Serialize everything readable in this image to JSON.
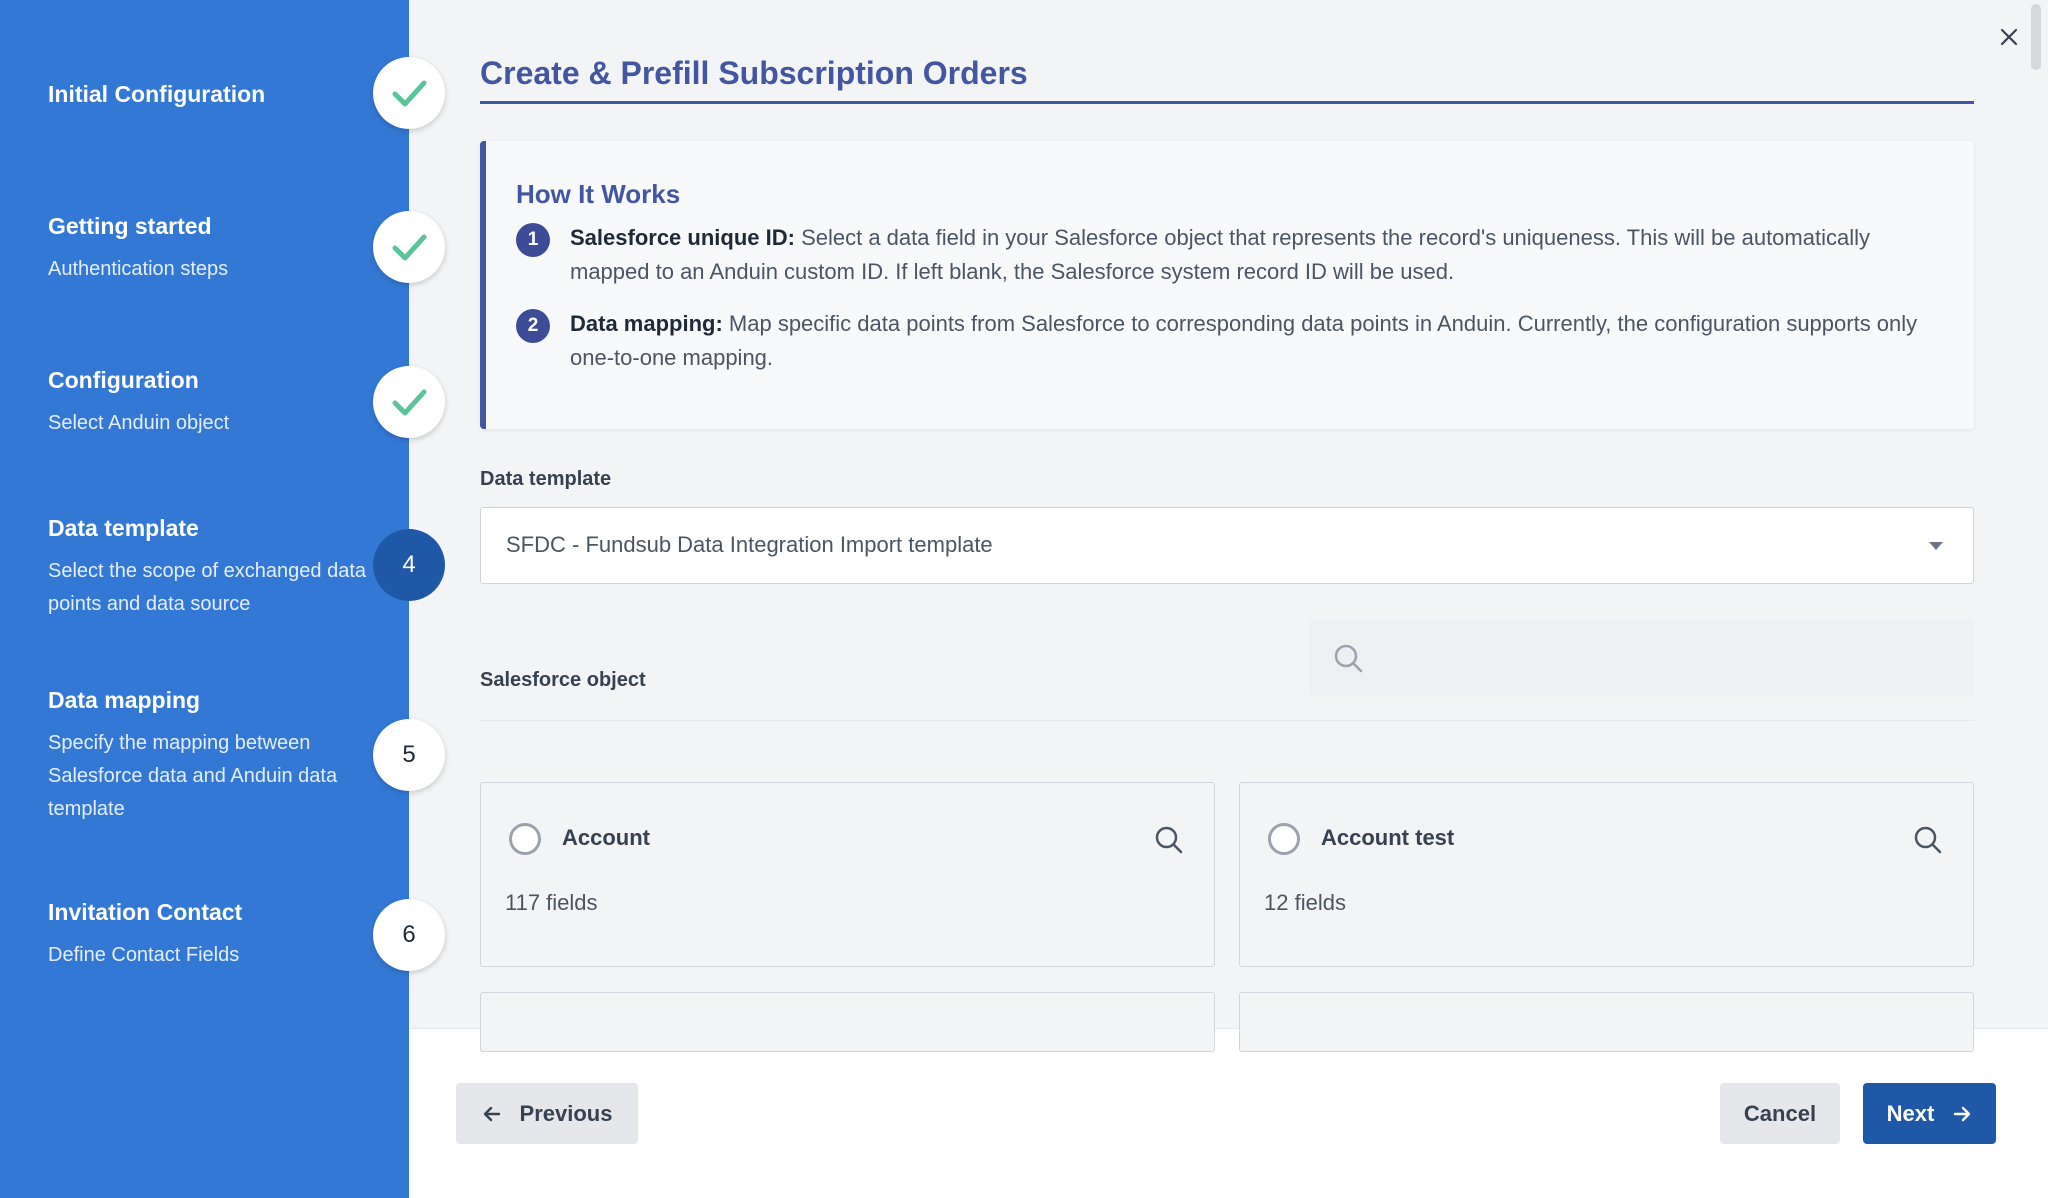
{
  "sidebar": {
    "steps": [
      {
        "title": "Initial Configuration",
        "subtitle": "",
        "status": "complete",
        "marker": ""
      },
      {
        "title": "Getting started",
        "subtitle": "Authentication steps",
        "status": "complete",
        "marker": ""
      },
      {
        "title": "Configuration",
        "subtitle": "Select Anduin object",
        "status": "complete",
        "marker": ""
      },
      {
        "title": "Data template",
        "subtitle": "Select the scope of exchanged data points and data source",
        "status": "active",
        "marker": "4"
      },
      {
        "title": "Data mapping",
        "subtitle": "Specify the mapping between Salesforce data and Anduin data template",
        "status": "pending",
        "marker": "5"
      },
      {
        "title": "Invitation Contact",
        "subtitle": "Define Contact Fields",
        "status": "pending",
        "marker": "6"
      }
    ]
  },
  "main": {
    "title": "Create & Prefill Subscription Orders",
    "how_it_works": {
      "title": "How It Works",
      "items": [
        {
          "num": "1",
          "label": "Salesforce unique ID:",
          "text": " Select a data field in your Salesforce object that represents the record's uniqueness. This will be automatically mapped to an Anduin custom ID. If left blank, the Salesforce system record ID will be used."
        },
        {
          "num": "2",
          "label": "Data mapping:",
          "text": " Map specific data points from Salesforce to corresponding data points in Anduin. Currently, the configuration supports only one-to-one mapping."
        }
      ]
    },
    "data_template": {
      "label": "Data template",
      "value": "SFDC - Fundsub Data Integration Import template"
    },
    "salesforce_object": {
      "label": "Salesforce object",
      "search_placeholder": "",
      "cards": [
        {
          "name": "Account",
          "fields": "117 fields"
        },
        {
          "name": "Account test",
          "fields": "12 fields"
        }
      ]
    }
  },
  "footer": {
    "previous_label": "Previous",
    "cancel_label": "Cancel",
    "next_label": "Next"
  },
  "colors": {
    "sidebar": "#3478d6",
    "accent": "#4356a1",
    "primary_button": "#1f58a6",
    "check": "#5cc49a"
  }
}
